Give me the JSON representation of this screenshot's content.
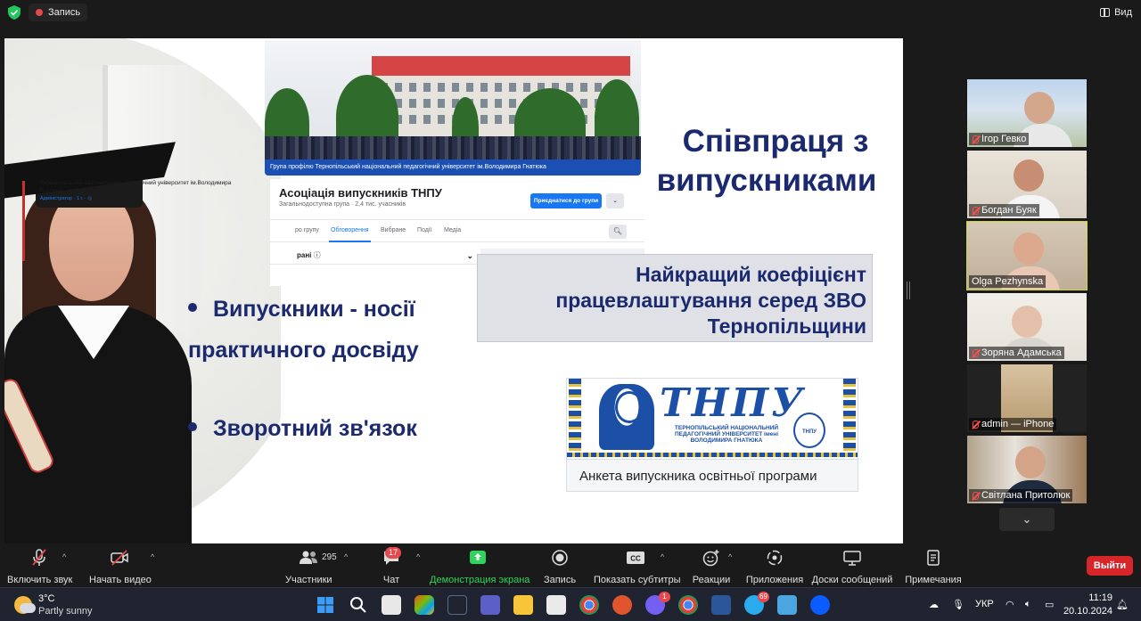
{
  "topbar": {
    "recording_label": "Запись",
    "view_label": "Вид"
  },
  "slide": {
    "title_line1": "Співпраця з",
    "title_line2": "випускниками",
    "rate_lines": [
      "Найкращий коефіцієнт",
      "працевлаштування серед ЗВО",
      "Тернопільщини"
    ],
    "bullet1_line1": "Випускники - носії",
    "bullet1_line2": "практичного досвіду",
    "bullet2": "Зворотний зв'язок",
    "facebook": {
      "banner_caption": "Група профілю Тернопільський національний педагогічний університет ім.Володимира Гнатюка",
      "group_title": "Асоціація випускників ТНПУ",
      "group_subtitle": "Загальнодоступна група · 2,4 тис. учасників",
      "join_button": "Приєднатися до групи",
      "more_button": "⌄",
      "tabs": [
        "ро групу",
        "Обговорення",
        "Вибране",
        "Події",
        "Медіа"
      ],
      "active_tab": "Обговорення",
      "sort_label": "рані",
      "post_author": "Тернопільський національний педагогічний університет ім.Володимира Гнатюка",
      "post_meta": "Адміністратор · 1 г. · ◎"
    },
    "tnpu": {
      "logo": "ТНПУ",
      "name": "ТЕРНОПІЛЬСЬКИЙ НАЦІОНАЛЬНИЙ ПЕДАГОГІЧНИЙ УНІВЕРСИТЕТ імені ВОЛОДИМИРА ГНАТЮКА",
      "emblem": "ТНПУ",
      "caption": "Анкета випускника освітньої програми"
    }
  },
  "participants": [
    {
      "name": "Ігор Гевко",
      "muted": true,
      "active": false
    },
    {
      "name": "Богдан Буяк",
      "muted": true,
      "active": false
    },
    {
      "name": "Olga Pezhynska",
      "muted": false,
      "active": true
    },
    {
      "name": "Зоряна Адамська",
      "muted": true,
      "active": false
    },
    {
      "name": "admin — iPhone",
      "muted": true,
      "active": false
    },
    {
      "name": "Світлана Притолюк",
      "muted": true,
      "active": false
    }
  ],
  "participants_scroll_icon": "⌄",
  "toolbar": {
    "unmute": "Включить звук",
    "start_video": "Начать видео",
    "participants": "Участники",
    "participants_count": "295",
    "chat": "Чат",
    "chat_badge": "17",
    "share": "Демонстрация экрана",
    "record": "Запись",
    "captions": "Показать субтитры",
    "reactions": "Реакции",
    "apps": "Приложения",
    "whiteboards": "Доски сообщений",
    "notes": "Примечания",
    "leave": "Выйти",
    "caret": "^"
  },
  "taskbar": {
    "temperature": "3°C",
    "weather": "Partly sunny",
    "language": "УКР",
    "time": "11:19",
    "date": "20.10.2024",
    "viber_badge": "1",
    "telegram_badge": "69"
  },
  "colors": {
    "slide_navy": "#1b2a6e",
    "leave_red": "#d7262a",
    "share_green": "#2fd35b",
    "active_speaker": "#c6d64a"
  }
}
